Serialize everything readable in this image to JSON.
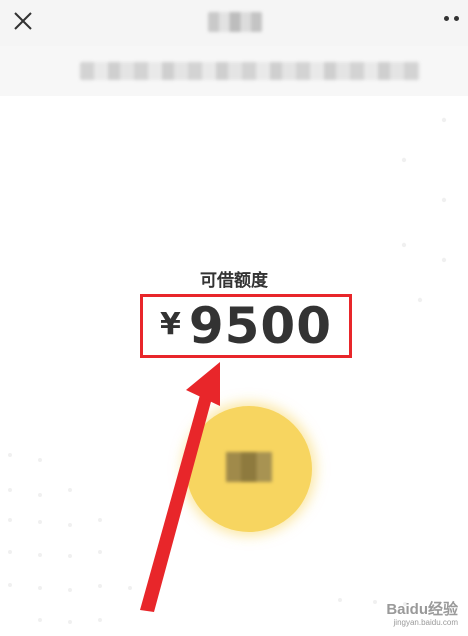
{
  "header": {
    "close_icon": "close-icon",
    "more_icon": "more-dots-icon"
  },
  "credit": {
    "label": "可借额度",
    "currency": "¥",
    "amount": "9500"
  },
  "colors": {
    "highlight_border": "#e8262a",
    "arrow": "#e8262a",
    "action_circle": "#f7d560"
  },
  "watermark": {
    "brand": "Baidu经验",
    "url": "jingyan.baidu.com"
  }
}
